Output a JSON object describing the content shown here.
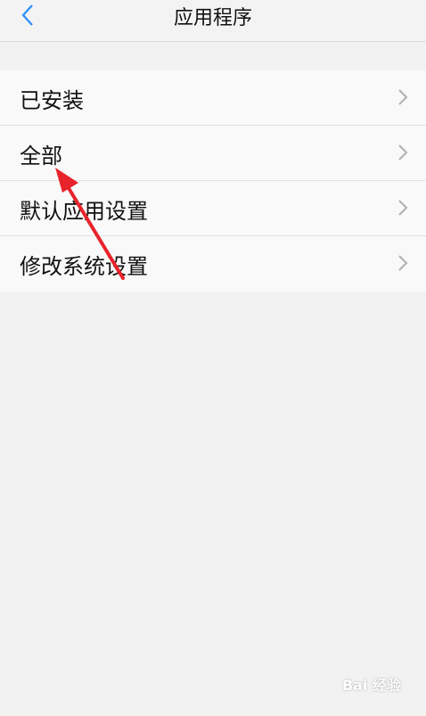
{
  "header": {
    "title": "应用程序",
    "back_icon": "chevron-left-icon"
  },
  "list": {
    "items": [
      {
        "label": "已安装"
      },
      {
        "label": "全部"
      },
      {
        "label": "默认应用设置"
      },
      {
        "label": "修改系统设置"
      }
    ],
    "chevron_icon": "chevron-right-icon"
  },
  "annotation": {
    "type": "red-arrow",
    "points_to": "全部",
    "color": "#e8232b"
  },
  "watermark": {
    "text": "Bai 经验"
  },
  "colors": {
    "accent": "#2b8cff",
    "background": "#f2f2f2",
    "row_bg": "#f9f9f9"
  }
}
